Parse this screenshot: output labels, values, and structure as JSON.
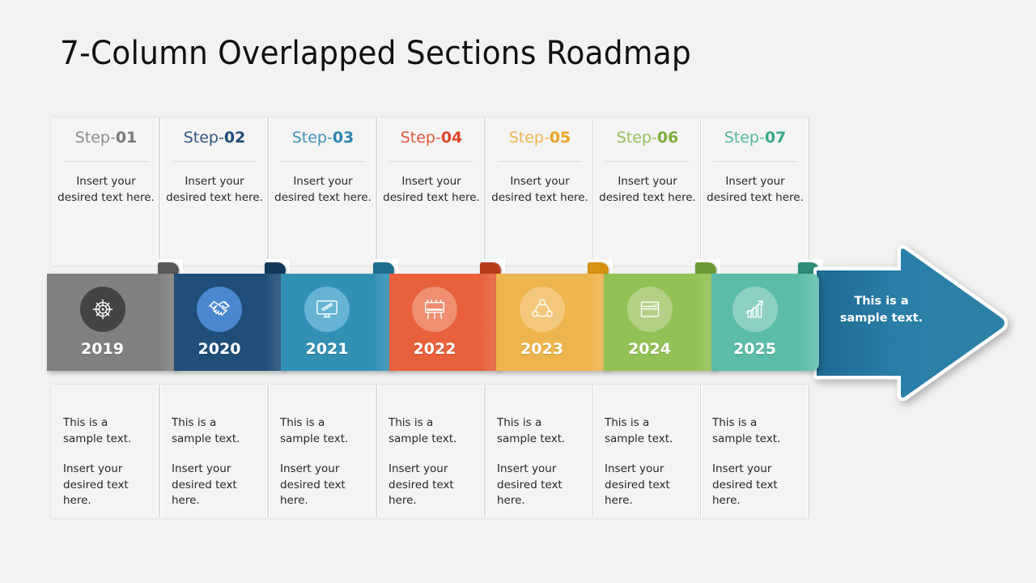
{
  "slide": {
    "title": "7-Column Overlapped Sections Roadmap",
    "background_color": "#f2f2f2"
  },
  "columns": [
    {
      "step_prefix": "Step-",
      "step_number": "01",
      "step_color": "#8c8c8c",
      "step_number_color": "#7a7a7a",
      "top_text": "Insert your desired text here.",
      "year": "2019",
      "icon": "target-icon",
      "bar_color": "#808080",
      "fold_color": "#595959",
      "icon_circle_color": "#444444",
      "bottom_heading": "This is a sample text.",
      "bottom_text": "Insert your desired text here."
    },
    {
      "step_prefix": "Step-",
      "step_number": "02",
      "step_color": "#31557f",
      "step_number_color": "#1f4e79",
      "top_text": "Insert your desired text here.",
      "year": "2020",
      "icon": "handshake-icon",
      "bar_color": "#1f4e79",
      "fold_color": "#133a5c",
      "icon_circle_color": "#4a87ce",
      "bottom_heading": "This is a sample text.",
      "bottom_text": "Insert your desired text here."
    },
    {
      "step_prefix": "Step-",
      "step_number": "03",
      "step_color": "#4292b8",
      "step_number_color": "#2d86b0",
      "top_text": "Insert your desired text here.",
      "year": "2021",
      "icon": "monitor-icon",
      "bar_color": "#3290b5",
      "fold_color": "#1f6e8e",
      "icon_circle_color": "#66b3d4",
      "bottom_heading": "This is a sample text.",
      "bottom_text": "Insert your desired text here."
    },
    {
      "step_prefix": "Step-",
      "step_number": "04",
      "step_color": "#e05a3b",
      "step_number_color": "#d9472a",
      "top_text": "Insert your desired text here.",
      "year": "2022",
      "icon": "billboard-icon",
      "bar_color": "#e8603c",
      "fold_color": "#b83c1c",
      "icon_circle_color": "#ef8e71",
      "bottom_heading": "This is a sample text.",
      "bottom_text": "Insert your desired text here."
    },
    {
      "step_prefix": "Step-",
      "step_number": "05",
      "step_color": "#efb54f",
      "step_number_color": "#e8a427",
      "top_text": "Insert your desired text here.",
      "year": "2023",
      "icon": "network-icon",
      "bar_color": "#eeb44d",
      "fold_color": "#d79113",
      "icon_circle_color": "#f3c87c",
      "bottom_heading": "This is a sample text.",
      "bottom_text": "Insert your desired text here."
    },
    {
      "step_prefix": "Step-",
      "step_number": "06",
      "step_color": "#94bd5b",
      "step_number_color": "#7cae3b",
      "top_text": "Insert your desired text here.",
      "year": "2024",
      "icon": "browser-window-icon",
      "bar_color": "#93c155",
      "fold_color": "#6d9a35",
      "icon_circle_color": "#b2d186",
      "bottom_heading": "This is a sample text.",
      "bottom_text": "Insert your desired text here."
    },
    {
      "step_prefix": "Step-",
      "step_number": "07",
      "step_color": "#58b69e",
      "step_number_color": "#38a88a",
      "top_text": "Insert your desired text here.",
      "year": "2025",
      "icon": "growth-chart-icon",
      "bar_color": "#5cbcaa",
      "fold_color": "#2e8c7a",
      "icon_circle_color": "#8ed0c3",
      "bottom_heading": "This is a sample text.",
      "bottom_text": "Insert your desired text here."
    }
  ],
  "arrow": {
    "text": "This is a sample text.",
    "color_start": "#2a7fa8",
    "color_end": "#2b7fa6",
    "name": "arrow-right-shape"
  }
}
